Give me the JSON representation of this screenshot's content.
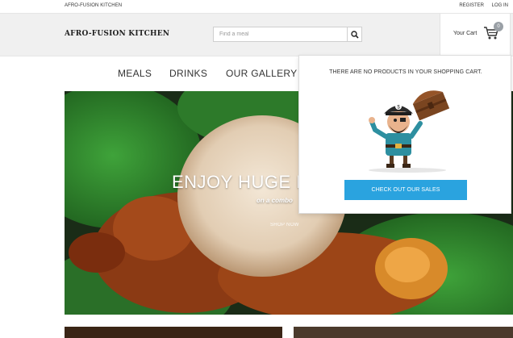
{
  "topbar": {
    "brand": "AFRO-FUSION KITCHEN",
    "register": "REGISTER",
    "login": "LOG IN"
  },
  "header": {
    "logo": "AFRO-FUSION KITCHEN",
    "search_placeholder": "Find a meal",
    "cart_label": "Your Cart",
    "cart_count": "0"
  },
  "nav": {
    "items": [
      "MEALS",
      "DRINKS",
      "OUR GALLERY"
    ]
  },
  "hero": {
    "title": "ENJOY HUGE DISCOUNTS",
    "subtitle": "on a combo",
    "shop_label": "SHOP NOW"
  },
  "cart_dropdown": {
    "empty_message": "THERE ARE NO PRODUCTS IN YOUR SHOPPING CART.",
    "checkout_label": "CHECK OUT OUR SALES"
  },
  "colors": {
    "accent": "#2aa3df",
    "header_bg": "#f0f0f0",
    "badge": "#9aa0a6"
  },
  "icons": [
    "search-icon",
    "cart-icon",
    "pirate-mascot-icon"
  ]
}
